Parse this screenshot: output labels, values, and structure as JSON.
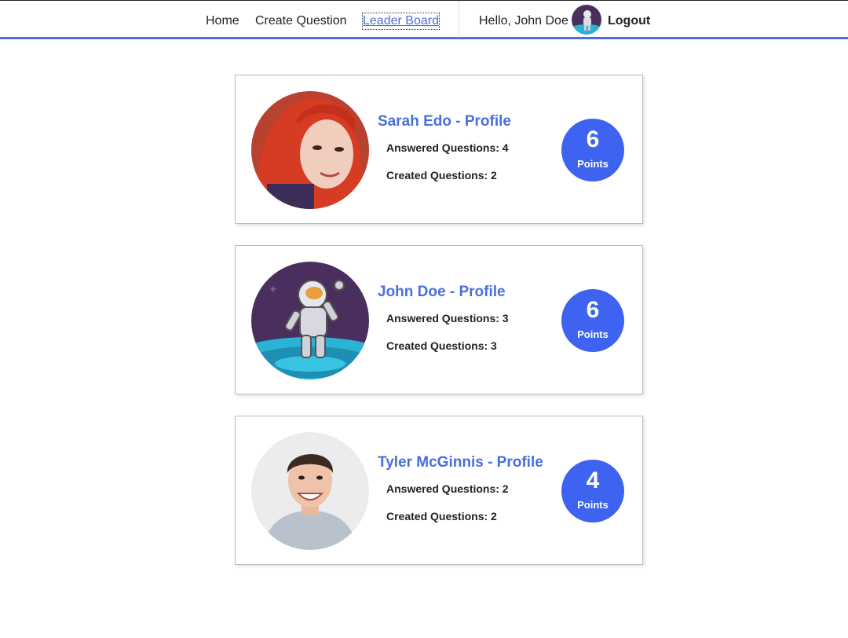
{
  "nav": {
    "home": "Home",
    "create_question": "Create Question",
    "leader_board": "Leader Board",
    "greeting": "Hello, John Doe",
    "logout": "Logout"
  },
  "leaderboard": [
    {
      "name": "Sarah Edo - Profile",
      "answered": "Answered Questions: 4",
      "created": "Created Questions: 2",
      "points": "6",
      "points_label": "Points"
    },
    {
      "name": "John Doe - Profile",
      "answered": "Answered Questions: 3",
      "created": "Created Questions: 3",
      "points": "6",
      "points_label": "Points"
    },
    {
      "name": "Tyler McGinnis - Profile",
      "answered": "Answered Questions: 2",
      "created": "Created Questions: 2",
      "points": "4",
      "points_label": "Points"
    }
  ],
  "colors": {
    "accent": "#4a6fdc",
    "score_badge": "#3d63f0"
  }
}
